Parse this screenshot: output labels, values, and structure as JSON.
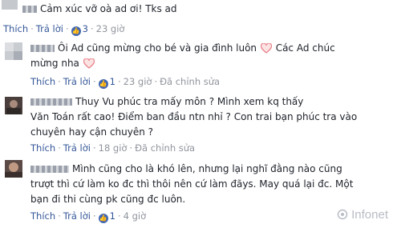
{
  "comments": [
    {
      "text": "Cảm xúc vỡ oà ad ơi! Tks ad",
      "actions": {
        "like": "Thích",
        "reply": "Trả lời",
        "likes": "3",
        "time": "23 giờ"
      }
    },
    {
      "text_before_heart": "Ôi Ad cũng mừng cho bé và gia đình luôn",
      "text_after_heart": "Các Ad chúc",
      "text_line2": "mừng nha",
      "actions": {
        "like": "Thích",
        "reply": "Trả lời",
        "likes": "1",
        "time": "23 giờ",
        "edited": "Đã chỉnh sửa"
      }
    },
    {
      "lines": [
        "Thuy Vu phúc tra mấy môn ? Mình xem kq thấy",
        "Văn Toán rất cao! Điểm ban đầu ntn nhỉ ? Con trai bạn phúc tra vào",
        "chuyên hay cận chuyên ?"
      ],
      "actions": {
        "like": "Thích",
        "reply": "Trả lời",
        "time": "18 giờ",
        "edited": "Đã chỉnh sửa"
      }
    },
    {
      "lines": [
        "Mình cũng cho là khó lên, nhưng lại nghĩ đằng nào cũng",
        "trượt thì cứ làm ko đc thì thôi nên cứ làm đãys. May quá lại đc. Một",
        "bạn đi thi cùng pk cũng đc luôn."
      ],
      "actions": {
        "like": "Thích",
        "reply": "Trả lời",
        "likes": "1",
        "time": "4 giờ"
      }
    }
  ],
  "watermark": "Infonet",
  "colors": {
    "link": "#365899",
    "meta": "#90949c",
    "like_badge": "#4267b2",
    "heart": "#e8838a"
  }
}
